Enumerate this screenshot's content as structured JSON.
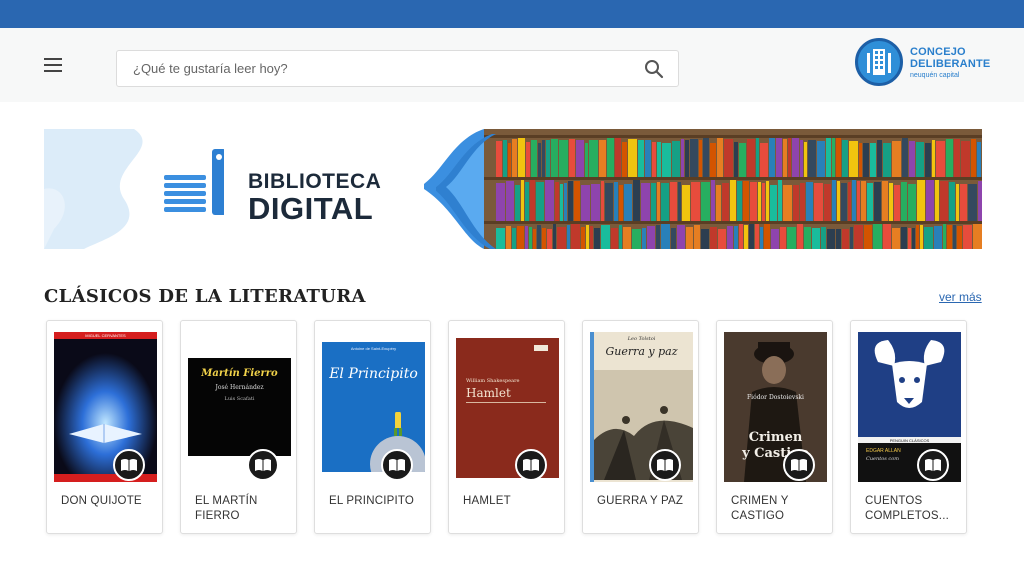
{
  "header": {
    "search_placeholder": "¿Qué te gustaría leer hoy?",
    "logo_line1": "CONCEJO",
    "logo_line2": "DELIBERANTE",
    "logo_line3": "neuquén capital"
  },
  "banner": {
    "line1": "BIBLIOTECA",
    "line2": "DIGITAL"
  },
  "section": {
    "title": "CLÁSICOS DE LA LITERATURA",
    "more_label": "ver más"
  },
  "books": [
    {
      "title": "DON QUIJOTE"
    },
    {
      "title": "EL MARTÍN FIERRO"
    },
    {
      "title": "EL PRINCIPITO"
    },
    {
      "title": "HAMLET"
    },
    {
      "title": "GUERRA Y PAZ"
    },
    {
      "title": "CRIMEN Y CASTIGO"
    },
    {
      "title": "CUENTOS COMPLETOS..."
    }
  ],
  "covers": {
    "quijote_author": "MIGUEL CERVANTES",
    "fierro_title": "Martín Fierro",
    "fierro_author": "José Hernández",
    "fierro_illustrator": "Luis Scafati",
    "principito_author": "Antoine de Saint-Exupéry",
    "principito_title": "El Principito",
    "hamlet_author": "William Shakespeare",
    "hamlet_title": "Hamlet",
    "guerra_author": "Leo Tolstoi",
    "guerra_title": "Guerra y paz",
    "crimen_author": "Fiódor Dostoievski",
    "crimen_title1": "Crimen",
    "crimen_title2": "y Castigo",
    "cuentos_author": "EDGAR ALLAN",
    "cuentos_sub": "Cuentos com",
    "cuentos_series": "PENGUIN  CLÁSICOS"
  },
  "colors": {
    "topbar": "#2a67b1",
    "accent": "#2a7fcc"
  },
  "icons": {
    "menu": "hamburger-icon",
    "search": "search-icon",
    "read": "open-book-icon"
  }
}
